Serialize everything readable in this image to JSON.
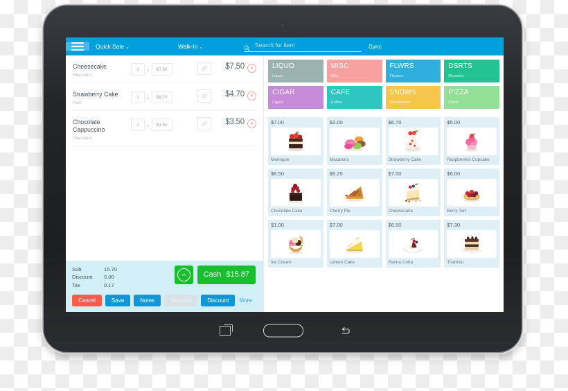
{
  "device": {
    "nav": {
      "recents_label": "recents",
      "home_label": "home",
      "back_label": "back"
    }
  },
  "topbar": {
    "menu_label": "menu",
    "quick_sale": "Quick Sale",
    "walk_in": "Walk-In",
    "caret": "⌄",
    "sync_label": "Sync",
    "search": {
      "value": "",
      "placeholder": "Search for item"
    }
  },
  "cart": {
    "lines": [
      {
        "name": "Cheesecake",
        "variant": "Standard.",
        "qty": "1",
        "unit_price": "$7.50",
        "total": "$7.50",
        "mult": "×"
      },
      {
        "name": "Strawberry Cake",
        "variant": "Half.",
        "qty": "1",
        "unit_price": "$6.70",
        "total": "$4.70",
        "mult": "×"
      },
      {
        "name": "Chocolate Cappuccino",
        "variant": "Standard.",
        "qty": "1",
        "unit_price": "$3.50",
        "total": "$3.50",
        "mult": "×"
      }
    ],
    "totals": [
      {
        "label": "Sub",
        "value": "15.70"
      },
      {
        "label": "Discount",
        "value": "0.00"
      },
      {
        "label": "Tax",
        "value": "0.17"
      }
    ],
    "cash_label": "Cash",
    "cash_amount": "$15.87",
    "buttons": {
      "cancel": "Cancel",
      "save": "Save",
      "notes": "Notes",
      "terminal": "Terminal",
      "discount": "Discount",
      "more": "More"
    }
  },
  "categories": [
    {
      "code": "LIQUO",
      "name": "Liquor",
      "color": "#9bb2b0"
    },
    {
      "code": "MISC",
      "name": "Misc",
      "color": "#f7a0a0"
    },
    {
      "code": "FLWRS",
      "name": "Flowers",
      "color": "#2eafdd"
    },
    {
      "code": "DSRTS",
      "name": "Desserts",
      "color": "#22c391"
    },
    {
      "code": "CIGAR",
      "name": "Cigars",
      "color": "#c68ad8"
    },
    {
      "code": "CAFE",
      "name": "Coffee",
      "color": "#2fc5c0"
    },
    {
      "code": "SNDWS",
      "name": "Sandwiches",
      "color": "#f6c54b"
    },
    {
      "code": "PIZZA",
      "name": "Pizza",
      "color": "#92e096"
    }
  ],
  "products": [
    {
      "price": "$7.00",
      "name": "Meringue",
      "icon": "meringue"
    },
    {
      "price": "$3.00",
      "name": "Macarons",
      "icon": "macarons"
    },
    {
      "price": "$6.70",
      "name": "Strawberry Cake",
      "icon": "strawberry-cake"
    },
    {
      "price": "$5.00",
      "name": "Raspberries Cupcake",
      "icon": "cupcake"
    },
    {
      "price": "$6.50",
      "name": "Chocolate Cake",
      "icon": "chocolate-cake"
    },
    {
      "price": "$6.25",
      "name": "Cherry Pie",
      "icon": "cherry-pie"
    },
    {
      "price": "$7.50",
      "name": "Cheesecake",
      "icon": "cheesecake"
    },
    {
      "price": "$6.00",
      "name": "Berry Tart",
      "icon": "berry-tart"
    },
    {
      "price": "$1.00",
      "name": "Ice Cream",
      "icon": "ice-cream"
    },
    {
      "price": "$7.00",
      "name": "Lemon Cake",
      "icon": "lemon-cake"
    },
    {
      "price": "$6.50",
      "name": "Panna Cotta",
      "icon": "panna-cotta"
    },
    {
      "price": "$7.30",
      "name": "Tiramisu",
      "icon": "tiramisu"
    }
  ],
  "colors": {
    "accent_blue": "#00a0dd",
    "light_blue": "#40bdee",
    "green": "#18bf2c",
    "red": "#fb5b4a",
    "totals_bg": "#d2eef7",
    "tile_bg": "#dfeff6"
  }
}
